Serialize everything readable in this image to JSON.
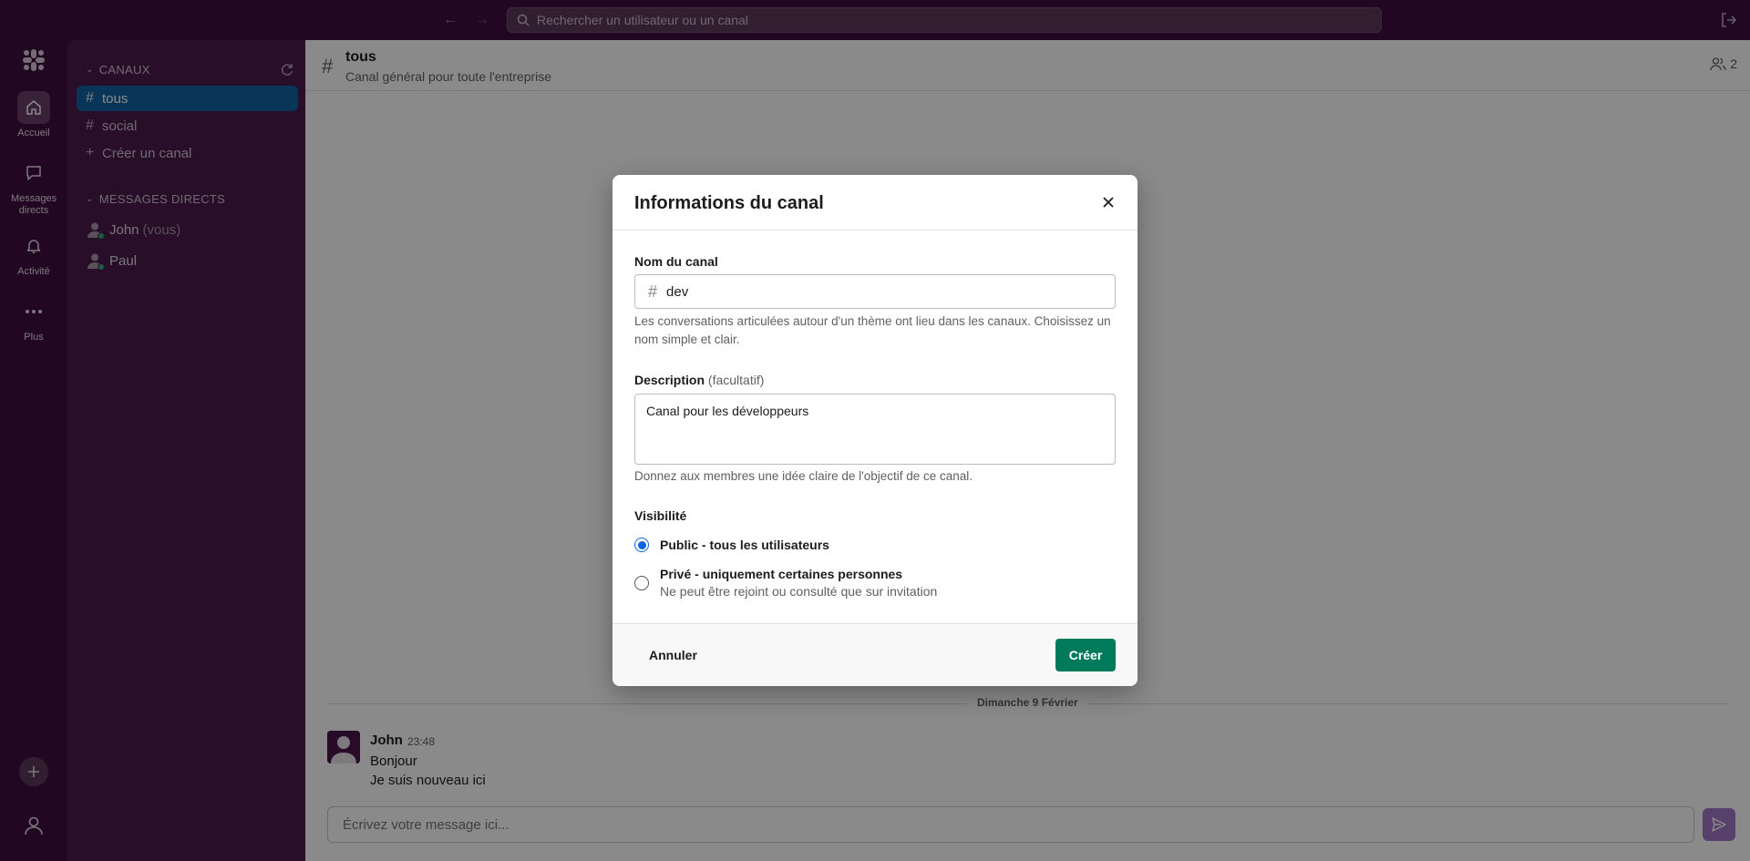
{
  "topbar": {
    "search_placeholder": "Rechercher un utilisateur ou un canal"
  },
  "rail": {
    "items": [
      {
        "label": "Accueil",
        "icon": "home-icon"
      },
      {
        "label": "Messages directs",
        "icon": "message-icon"
      },
      {
        "label": "Activité",
        "icon": "bell-icon"
      },
      {
        "label": "Plus",
        "icon": "more-icon"
      }
    ]
  },
  "sidebar": {
    "channels_heading": "CANAUX",
    "channels": [
      {
        "name": "tous",
        "active": true
      },
      {
        "name": "social",
        "active": false
      }
    ],
    "create_channel": "Créer un canal",
    "dm_heading": "MESSAGES DIRECTS",
    "dms": [
      {
        "name": "John",
        "suffix": "(vous)"
      },
      {
        "name": "Paul",
        "suffix": ""
      }
    ]
  },
  "channel": {
    "name": "tous",
    "description": "Canal général pour toute l'entreprise",
    "member_count": "2"
  },
  "messages": {
    "day_label": "Dimanche 9 Février",
    "author": "John",
    "time": "23:48",
    "lines": [
      "Bonjour",
      "Je suis nouveau ici"
    ]
  },
  "composer": {
    "placeholder": "Écrivez votre message ici..."
  },
  "modal": {
    "title": "Informations du canal",
    "name_label": "Nom du canal",
    "name_value": "dev",
    "name_help": "Les conversations articulées autour d'un thème ont lieu dans les canaux. Choisissez un nom simple et clair.",
    "desc_label": "Description",
    "desc_optional": "(facultatif)",
    "desc_value": "Canal pour les développeurs",
    "desc_help": "Donnez aux membres une idée claire de l'objectif de ce canal.",
    "visibility_label": "Visibilité",
    "public_label": "Public - tous les utilisateurs",
    "private_label": "Privé - uniquement certaines personnes",
    "private_sub": "Ne peut être rejoint ou consulté que sur invitation",
    "cancel_label": "Annuler",
    "create_label": "Créer"
  },
  "colors": {
    "sidebar_bg": "#4a1a4b",
    "rail_bg": "#3f0e40",
    "active_channel": "#1164a3",
    "primary_button": "#007a5a",
    "radio_accent": "#1264e3",
    "send_button": "#a376c9"
  }
}
